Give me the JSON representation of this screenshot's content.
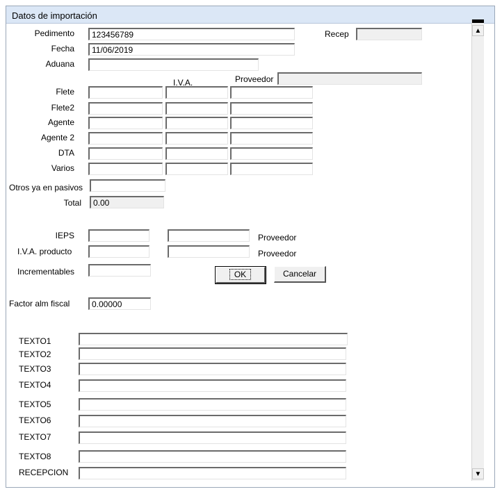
{
  "window": {
    "title": "Datos de importación"
  },
  "header": {
    "pedimento_label": "Pedimento",
    "pedimento_value": "123456789",
    "recep_label": "Recep",
    "recep_value": "",
    "fecha_label": "Fecha",
    "fecha_value": "11/06/2019",
    "aduana_label": "Aduana",
    "aduana_value": "",
    "iva_column_label": "I.V.A.",
    "proveedor_label": "Proveedor",
    "proveedor_value": ""
  },
  "costs": {
    "rows": [
      {
        "label": "Flete",
        "amount": "",
        "iva": "",
        "proveedor": ""
      },
      {
        "label": "Flete2",
        "amount": "",
        "iva": "",
        "proveedor": ""
      },
      {
        "label": "Agente",
        "amount": "",
        "iva": "",
        "proveedor": ""
      },
      {
        "label": "Agente 2",
        "amount": "",
        "iva": "",
        "proveedor": ""
      },
      {
        "label": "DTA",
        "amount": "",
        "iva": "",
        "proveedor": ""
      },
      {
        "label": "Varios",
        "amount": "",
        "iva": "",
        "proveedor": ""
      }
    ],
    "otros_label": "Otros ya en pasivos",
    "otros_value": "",
    "total_label": "Total",
    "total_value": "0.00"
  },
  "taxes": {
    "ieps_label": "IEPS",
    "ieps_value": "",
    "ieps_proveedor_value": "",
    "ieps_proveedor_label": "Proveedor",
    "iva_prod_label": "I.V.A. producto",
    "iva_prod_value": "",
    "iva_prod_proveedor_value": "",
    "iva_prod_proveedor_label": "Proveedor",
    "incrementables_label": "Incrementables",
    "incrementables_value": ""
  },
  "buttons": {
    "ok": "OK",
    "cancel": "Cancelar"
  },
  "factor": {
    "label": "Factor alm fiscal",
    "value": "0.00000"
  },
  "texts": [
    {
      "label": "TEXTO1",
      "value": ""
    },
    {
      "label": "TEXTO2",
      "value": ""
    },
    {
      "label": "TEXTO3",
      "value": ""
    },
    {
      "label": "TEXTO4",
      "value": ""
    },
    {
      "label": "TEXTO5",
      "value": ""
    },
    {
      "label": "TEXTO6",
      "value": ""
    },
    {
      "label": "TEXTO7",
      "value": ""
    },
    {
      "label": "TEXTO8",
      "value": ""
    },
    {
      "label": "RECEPCION",
      "value": ""
    }
  ],
  "scrollbar": {
    "up_icon": "arrow-up-icon",
    "down_icon": "arrow-down-icon"
  }
}
